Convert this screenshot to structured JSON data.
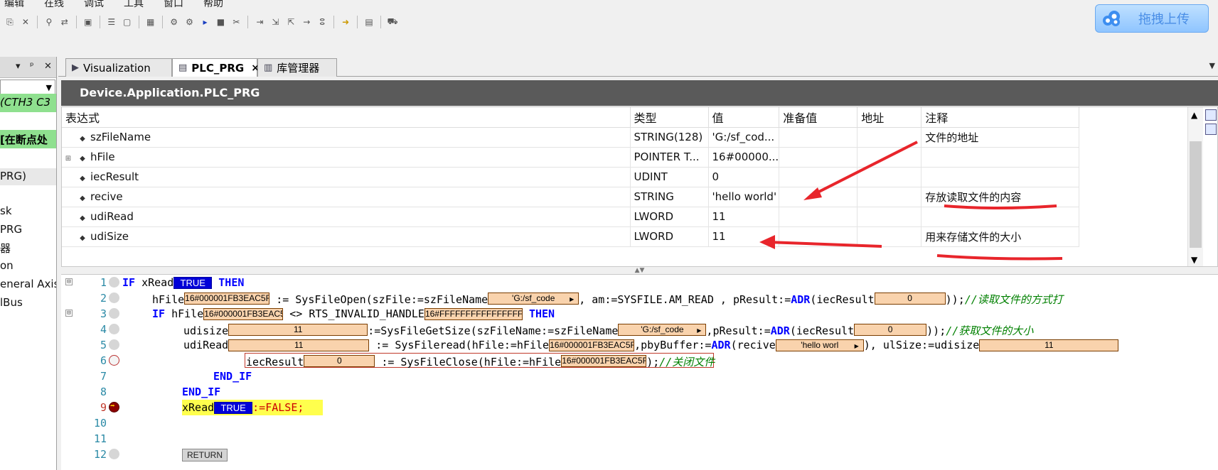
{
  "menu": [
    "编辑",
    "在线",
    "调试",
    "工具",
    "窗口",
    "帮助"
  ],
  "toolbar_icons": [
    "copy-icon",
    "delete-icon",
    "find-icon",
    "replace-icon",
    "select-all-icon",
    "menu-icon",
    "new-file-icon",
    "diagram-icon",
    "login-icon",
    "logout-icon",
    "run-icon",
    "stop-icon",
    "reset-icon",
    "step-over-icon",
    "step-into-icon",
    "step-out-icon",
    "run-to-cursor-icon",
    "breakpoint-icon",
    "write-icon",
    "watch-icon",
    "cart-icon"
  ],
  "upload": {
    "label": "拖拽上传"
  },
  "left_panel": {
    "items": [
      {
        "label": "(CTH3 C3",
        "kind": "green-italic"
      },
      {
        "label": "[在断点处",
        "kind": "green-bold"
      },
      {
        "label": "PRG)",
        "kind": "selected"
      },
      {
        "label": "sk"
      },
      {
        "label": "PRG"
      },
      {
        "label": "器"
      },
      {
        "label": "on"
      },
      {
        "label": "eneral Axis"
      },
      {
        "label": "lBus"
      }
    ]
  },
  "tabs": [
    {
      "label": "Visualization",
      "icon": "visualization-icon",
      "active": false
    },
    {
      "label": "PLC_PRG",
      "icon": "program-icon",
      "active": true,
      "close": "×"
    },
    {
      "label": "库管理器",
      "icon": "library-icon",
      "active": false
    }
  ],
  "path": "Device.Application.PLC_PRG",
  "watch": {
    "columns": [
      "表达式",
      "类型",
      "值",
      "准备值",
      "地址",
      "注释"
    ],
    "rows": [
      {
        "expr": "szFileName",
        "type": "STRING(128)",
        "value": "'G:/sf_cod...",
        "prepared": "",
        "address": "",
        "comment": "文件的地址",
        "expandable": false
      },
      {
        "expr": "hFile",
        "type": "POINTER T...",
        "value": "16#00000...",
        "prepared": "",
        "address": "",
        "comment": "",
        "expandable": true
      },
      {
        "expr": "iecResult",
        "type": "UDINT",
        "value": "0",
        "prepared": "",
        "address": "",
        "comment": "",
        "expandable": false
      },
      {
        "expr": "recive",
        "type": "STRING",
        "value": "'hello world'",
        "prepared": "",
        "address": "",
        "comment": "存放读取文件的内容",
        "expandable": false
      },
      {
        "expr": "udiRead",
        "type": "LWORD",
        "value": "11",
        "prepared": "",
        "address": "",
        "comment": "",
        "expandable": false
      },
      {
        "expr": "udiSize",
        "type": "LWORD",
        "value": "11",
        "prepared": "",
        "address": "",
        "comment": "用来存储文件的大小",
        "expandable": false
      }
    ]
  },
  "code": {
    "line_numbers": [
      "1",
      "2",
      "3",
      "4",
      "5",
      "6",
      "7",
      "8",
      "9",
      "10",
      "11",
      "12"
    ],
    "l1": {
      "kw_if": "IF",
      "var": "xRead",
      "iv": "TRUE",
      "kw_then": "THEN"
    },
    "l2": {
      "var": "hFile",
      "iv1": "16#000001FB3EAC5F58",
      "op": ":=",
      "fn": "SysFileOpen(szFile:=szFileName",
      "iv2": "'G:/sf_code",
      "mid": ", am:=SYSFILE.AM_READ , pResult:=",
      "adr": "ADR",
      "arg": "(iecResult",
      "iv3": "0",
      "end": "));",
      "comment": "//读取文件的方式打"
    },
    "l3": {
      "kw_if": "IF",
      "var": "hFile",
      "iv1": "16#000001FB3EAC5F58",
      "op": "<>",
      "fn": "RTS_INVALID_HANDLE",
      "iv2": "16#FFFFFFFFFFFFFFFF",
      "kw_then": "THEN"
    },
    "l4": {
      "var": "udisize",
      "iv1": "11",
      "fn": ":=SysFileGetSize(szFileName:=szFileName",
      "iv2": "'G:/sf_code",
      "mid": ",pResult:=",
      "adr": "ADR",
      "arg": "(iecResult",
      "iv3": "0",
      "end": "));",
      "comment": "//获取文件的大小"
    },
    "l5": {
      "var": "udiRead",
      "iv1": "11",
      "fn": ":= SysFileread(hFile:=hFile",
      "iv2": "16#000001FB3EAC5F58",
      "mid": ",pbyBuffer:=",
      "adr": "ADR",
      "arg": "(recive",
      "iv3": "'hello worl",
      "end": "), ulSize:=udisize",
      "iv4": "11"
    },
    "l6": {
      "var": "iecResult",
      "iv1": "0",
      "fn": ":= SysFileClose(hFile:=hFile",
      "iv2": "16#000001FB3EAC5F58",
      "end": ");",
      "comment": "//关闭文件"
    },
    "l7": {
      "kw": "END_IF"
    },
    "l8": {
      "kw": "END_IF"
    },
    "l9": {
      "var": "xRead",
      "iv": "TRUE",
      "rest": ":=FALSE;"
    },
    "l12": {
      "ret": "RETURN"
    }
  },
  "colors": {
    "keyword": "#0000ff",
    "comment": "#008000",
    "inline_value": "#f9d3ad",
    "current_line": "#ffff4d",
    "annotation": "#e8252b"
  }
}
